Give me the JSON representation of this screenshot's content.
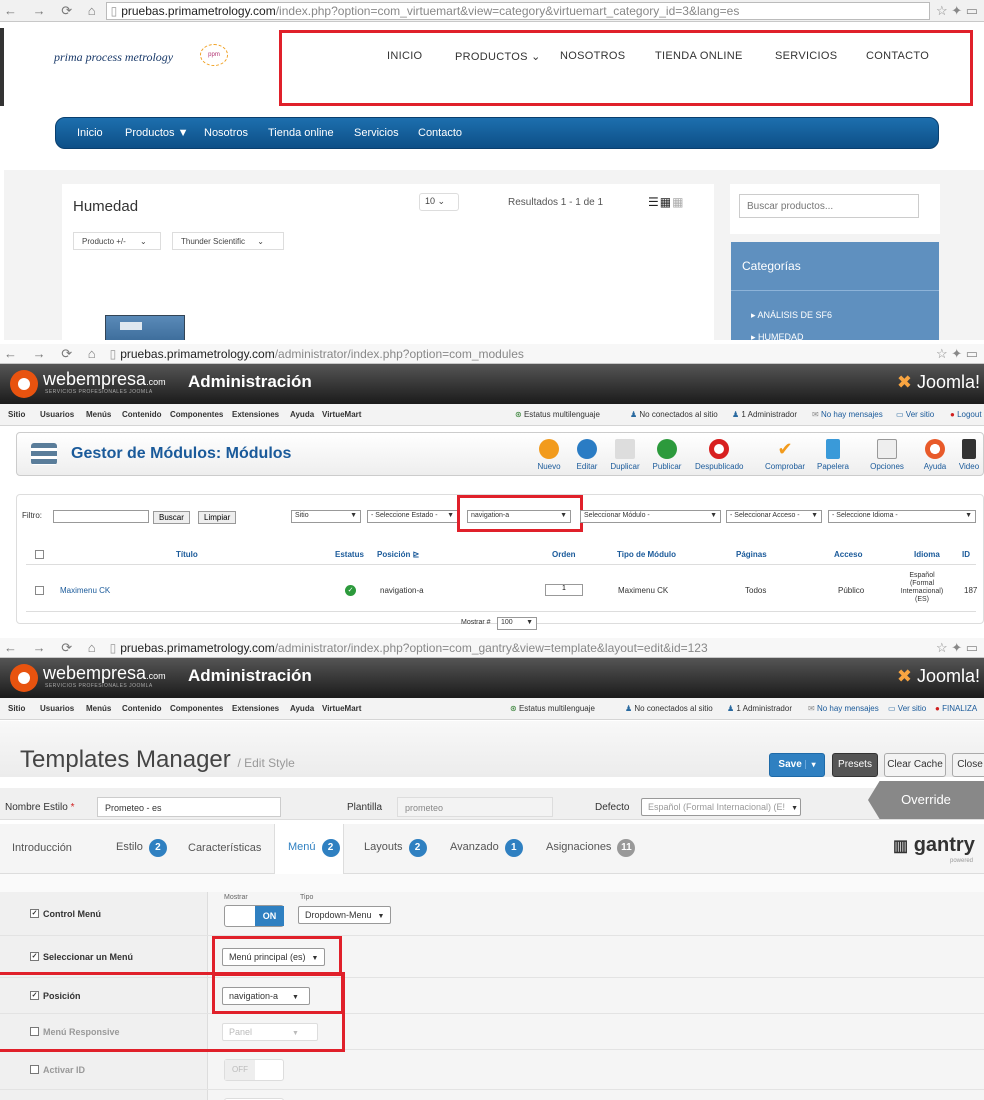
{
  "browser1": {
    "url_domain": "pruebas.primametrology.com",
    "url_rest": "/index.php?option=com_virtuemart&view=category&virtuemart_category_id=3&lang=es"
  },
  "site": {
    "logo": "prima process metrology",
    "logo_mark": "ppm",
    "nav": [
      "INICIO",
      "PRODUCTOS",
      "NOSOTROS",
      "TIENDA ONLINE",
      "SERVICIOS",
      "CONTACTO"
    ],
    "bluebar": [
      "Inicio",
      "Productos ▼",
      "Nosotros",
      "Tienda online",
      "Servicios",
      "Contacto"
    ],
    "category_title": "Humedad",
    "per_page": "10",
    "results": "Resultados 1 - 1 de 1",
    "filter1": "Producto +/-",
    "filter2": "Thunder Scientific",
    "search_placeholder": "Buscar productos...",
    "categories_title": "Categorías",
    "cat1": "ANÁLISIS DE SF6",
    "cat2": "HUMEDAD"
  },
  "browser2": {
    "url_domain": "pruebas.primametrology.com",
    "url_rest": "/administrator/index.php?option=com_modules"
  },
  "admin": {
    "brand": "webempresa",
    "brand_suffix": ".com",
    "brand_sub": "SERVICIOS PROFESIONALES JOOMLA",
    "title": "Administración",
    "joomla": "Joomla!",
    "menu": [
      "Sitio",
      "Usuarios",
      "Menús",
      "Contenido",
      "Componentes",
      "Extensiones",
      "Ayuda",
      "VirtueMart"
    ],
    "status1": "Estatus multilenguaje",
    "status2": "No conectados al sitio",
    "status3": "1 Administrador",
    "status4": "No hay mensajes",
    "status5": "Ver sitio",
    "status6": "Logout",
    "status6b": "FINALIZA"
  },
  "modules": {
    "title": "Gestor de Módulos: Módulos",
    "tools": [
      "Nuevo",
      "Editar",
      "Duplicar",
      "Publicar",
      "Despublicado",
      "Comprobar",
      "Papelera",
      "Opciones",
      "Ayuda",
      "Video"
    ],
    "filter_label": "Filtro:",
    "search_btn": "Buscar",
    "clear_btn": "Limpiar",
    "sel_site": "Sitio",
    "sel_state": "- Seleccione Estado -",
    "sel_position": "navigation-a",
    "sel_module": "Seleccionar Módulo -",
    "sel_access": "- Seleccionar Acceso -",
    "sel_lang": "- Seleccione Idioma -",
    "headers": [
      "Título",
      "Estatus",
      "Posición",
      "Orden",
      "Tipo de Módulo",
      "Páginas",
      "Acceso",
      "Idioma",
      "ID"
    ],
    "row": {
      "title": "Maximenu CK",
      "position": "navigation-a",
      "order": "1",
      "type": "Maximenu CK",
      "pages": "Todos",
      "access": "Público",
      "lang": "Español (Formal Internacional) (ES)",
      "id": "187"
    },
    "show_label": "Mostrar #",
    "show_value": "100"
  },
  "browser3": {
    "url_domain": "pruebas.primametrology.com",
    "url_rest": "/administrator/index.php?option=com_gantry&view=template&layout=edit&id=123"
  },
  "gantry": {
    "title": "Templates Manager",
    "subtitle": "/ Edit Style",
    "save": "Save",
    "presets": "Presets",
    "clear_cache": "Clear Cache",
    "close": "Close",
    "style_name_label": "Nombre Estilo",
    "style_name_value": "Prometeo - es",
    "template_label": "Plantilla",
    "template_value": "prometeo",
    "default_label": "Defecto",
    "default_value": "Español (Formal Internacional) (E!",
    "override": "Override",
    "tabs": [
      {
        "label": "Introducción",
        "badge": ""
      },
      {
        "label": "Estilo",
        "badge": "2"
      },
      {
        "label": "Características",
        "badge": ""
      },
      {
        "label": "Menú",
        "badge": "2"
      },
      {
        "label": "Layouts",
        "badge": "2"
      },
      {
        "label": "Avanzado",
        "badge": "1"
      },
      {
        "label": "Asignaciones",
        "badge": "11"
      }
    ],
    "gantry_logo": "gantry",
    "gantry_powered": "powered",
    "control_menu": "Control Menú",
    "show_label": "Mostrar",
    "type_label": "Tipo",
    "toggle_on": "ON",
    "type_value": "Dropdown-Menu",
    "select_menu": "Seleccionar un Menú",
    "select_menu_value": "Menú principal (es)",
    "position": "Posición",
    "position_value": "navigation-a",
    "responsive": "Menú Responsive",
    "responsive_value": "Panel",
    "activate_id": "Activar ID",
    "toggle_off": "OFF"
  }
}
